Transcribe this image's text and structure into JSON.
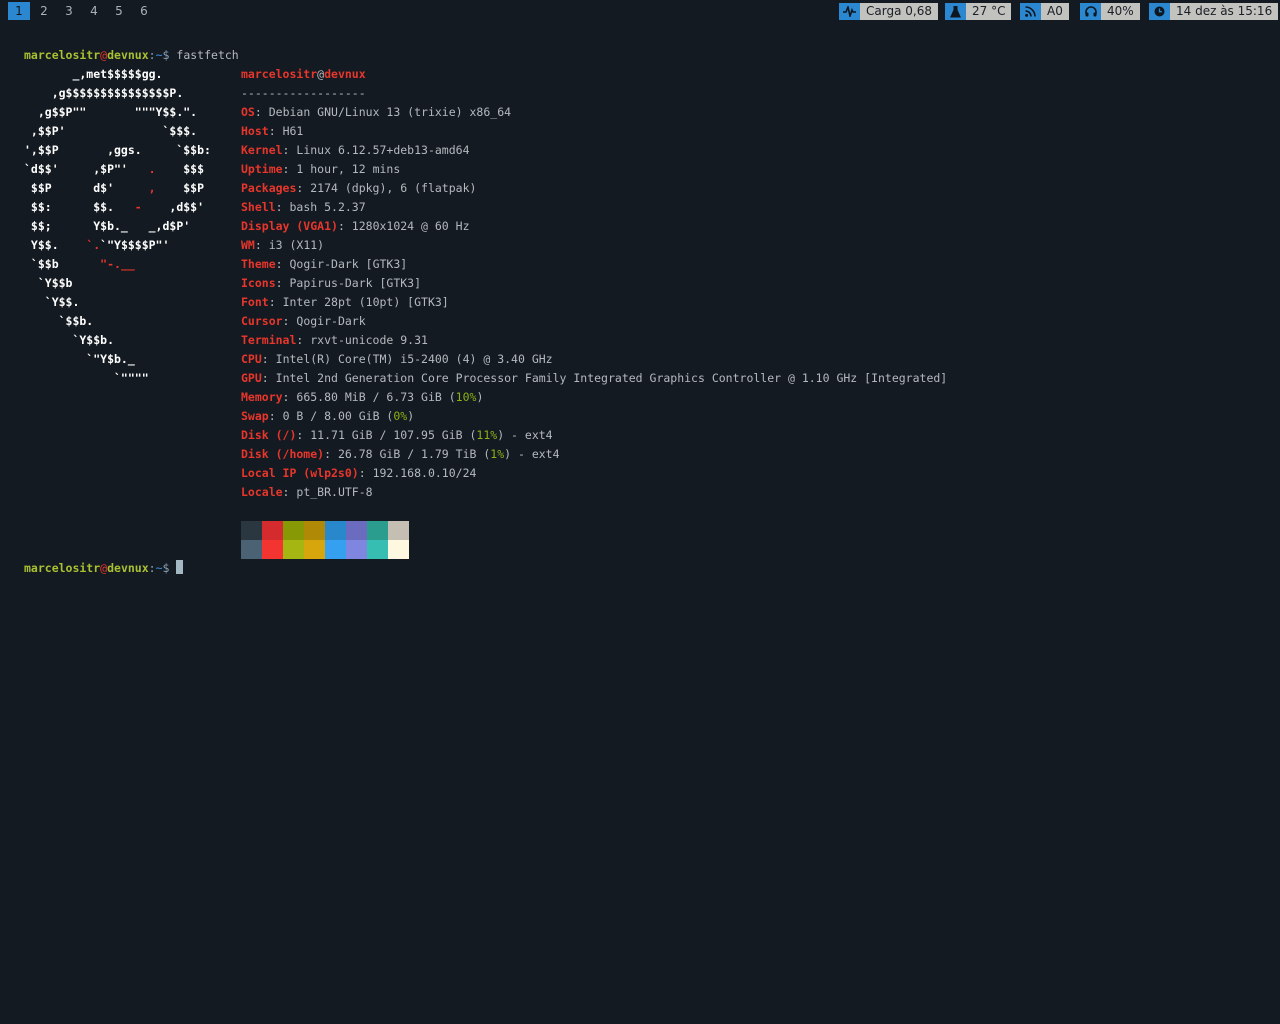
{
  "topbar": {
    "workspaces": [
      "1",
      "2",
      "3",
      "4",
      "5",
      "6"
    ],
    "active_workspace": "1",
    "status": {
      "load": "Carga 0,68",
      "temp": "27 °C",
      "network": "A0",
      "volume": "40%",
      "datetime": "14 dez às 15:16"
    }
  },
  "terminal": {
    "prompt": {
      "user": "marcelositr",
      "at": "@",
      "host": "devnux",
      "sep": ":",
      "path": "~",
      "symbol": "$"
    },
    "command": "fastfetch",
    "logo": [
      [
        "       _,met$$$$$gg.",
        ""
      ],
      [
        "    ,g$$$$$$$$$$$$$$$P.",
        ""
      ],
      [
        "  ,g$$P\"\"       \"\"\"Y$$.\".",
        ""
      ],
      [
        " ,$$P'              `$$$.",
        ""
      ],
      [
        "',$$P       ,ggs.     `$$b:",
        ""
      ],
      [
        "`d$$'     ,$P\"'   ",
        ".",
        "    $$$"
      ],
      [
        " $$P      d$'     ",
        ",",
        "    $$P"
      ],
      [
        " $$:      $$.   ",
        "-",
        "    ,d$$'"
      ],
      [
        " $$;      Y$b._   _,d$P'",
        ""
      ],
      [
        " Y$$.    ",
        "`.",
        "`\"Y$$$$P\"'"
      ],
      [
        " `$$b      ",
        "\"-.__",
        ""
      ],
      [
        "  `Y$$b",
        ""
      ],
      [
        "   `Y$$.",
        ""
      ],
      [
        "     `$$b.",
        ""
      ],
      [
        "       `Y$$b.",
        ""
      ],
      [
        "         `\"Y$b._",
        ""
      ],
      [
        "             `\"\"\"\"",
        ""
      ]
    ],
    "header": {
      "user": "marcelositr",
      "at": "@",
      "host": "devnux",
      "underline": "------------------"
    },
    "info": [
      {
        "key": "OS",
        "value": "Debian GNU/Linux 13 (trixie) x86_64"
      },
      {
        "key": "Host",
        "value": "H61"
      },
      {
        "key": "Kernel",
        "value": "Linux 6.12.57+deb13-amd64"
      },
      {
        "key": "Uptime",
        "value": "1 hour, 12 mins"
      },
      {
        "key": "Packages",
        "value": "2174 (dpkg), 6 (flatpak)"
      },
      {
        "key": "Shell",
        "value": "bash 5.2.37"
      },
      {
        "key": "Display (VGA1)",
        "value": "1280x1024 @ 60 Hz"
      },
      {
        "key": "WM",
        "value": "i3 (X11)"
      },
      {
        "key": "Theme",
        "value": "Qogir-Dark [GTK3]"
      },
      {
        "key": "Icons",
        "value": "Papirus-Dark [GTK3]"
      },
      {
        "key": "Font",
        "value": "Inter 28pt (10pt) [GTK3]"
      },
      {
        "key": "Cursor",
        "value": "Qogir-Dark"
      },
      {
        "key": "Terminal",
        "value": "rxvt-unicode 9.31"
      },
      {
        "key": "CPU",
        "value": "Intel(R) Core(TM) i5-2400 (4) @ 3.40 GHz"
      },
      {
        "key": "GPU",
        "value": "Intel 2nd Generation Core Processor Family Integrated Graphics Controller @ 1.10 GHz [Integrated]"
      },
      {
        "key": "Memory",
        "value_pre": "665.80 MiB / 6.73 GiB (",
        "value_hl": "10%",
        "value_post": ")"
      },
      {
        "key": "Swap",
        "value_pre": "0 B / 8.00 GiB (",
        "value_hl": "0%",
        "value_post": ")"
      },
      {
        "key": "Disk (/)",
        "value_pre": "11.71 GiB / 107.95 GiB (",
        "value_hl": "11%",
        "value_post": ") - ext4"
      },
      {
        "key": "Disk (/home)",
        "value_pre": "26.78 GiB / 1.79 TiB (",
        "value_hl": "1%",
        "value_post": ") - ext4"
      },
      {
        "key": "Local IP (wlp2s0)",
        "value": "192.168.0.10/24"
      },
      {
        "key": "Locale",
        "value": "pt_BR.UTF-8"
      }
    ],
    "palette": {
      "normal": [
        "#2a3640",
        "#d42c2e",
        "#879a06",
        "#b08a06",
        "#2987cc",
        "#6b6cc0",
        "#2a9d8e",
        "#c5bfb3"
      ],
      "bright": [
        "#4b6275",
        "#f43430",
        "#a5b613",
        "#d7a50c",
        "#35a0ef",
        "#7f86df",
        "#37beb2",
        "#fff8e0"
      ]
    }
  },
  "colors": {
    "bar_accent": "#2a87d0",
    "bar_pill": "#c2c2bf",
    "background": "#141a21",
    "key_red": "#e8362c",
    "user_green": "#a9c031",
    "percent_green": "#8bb214"
  }
}
